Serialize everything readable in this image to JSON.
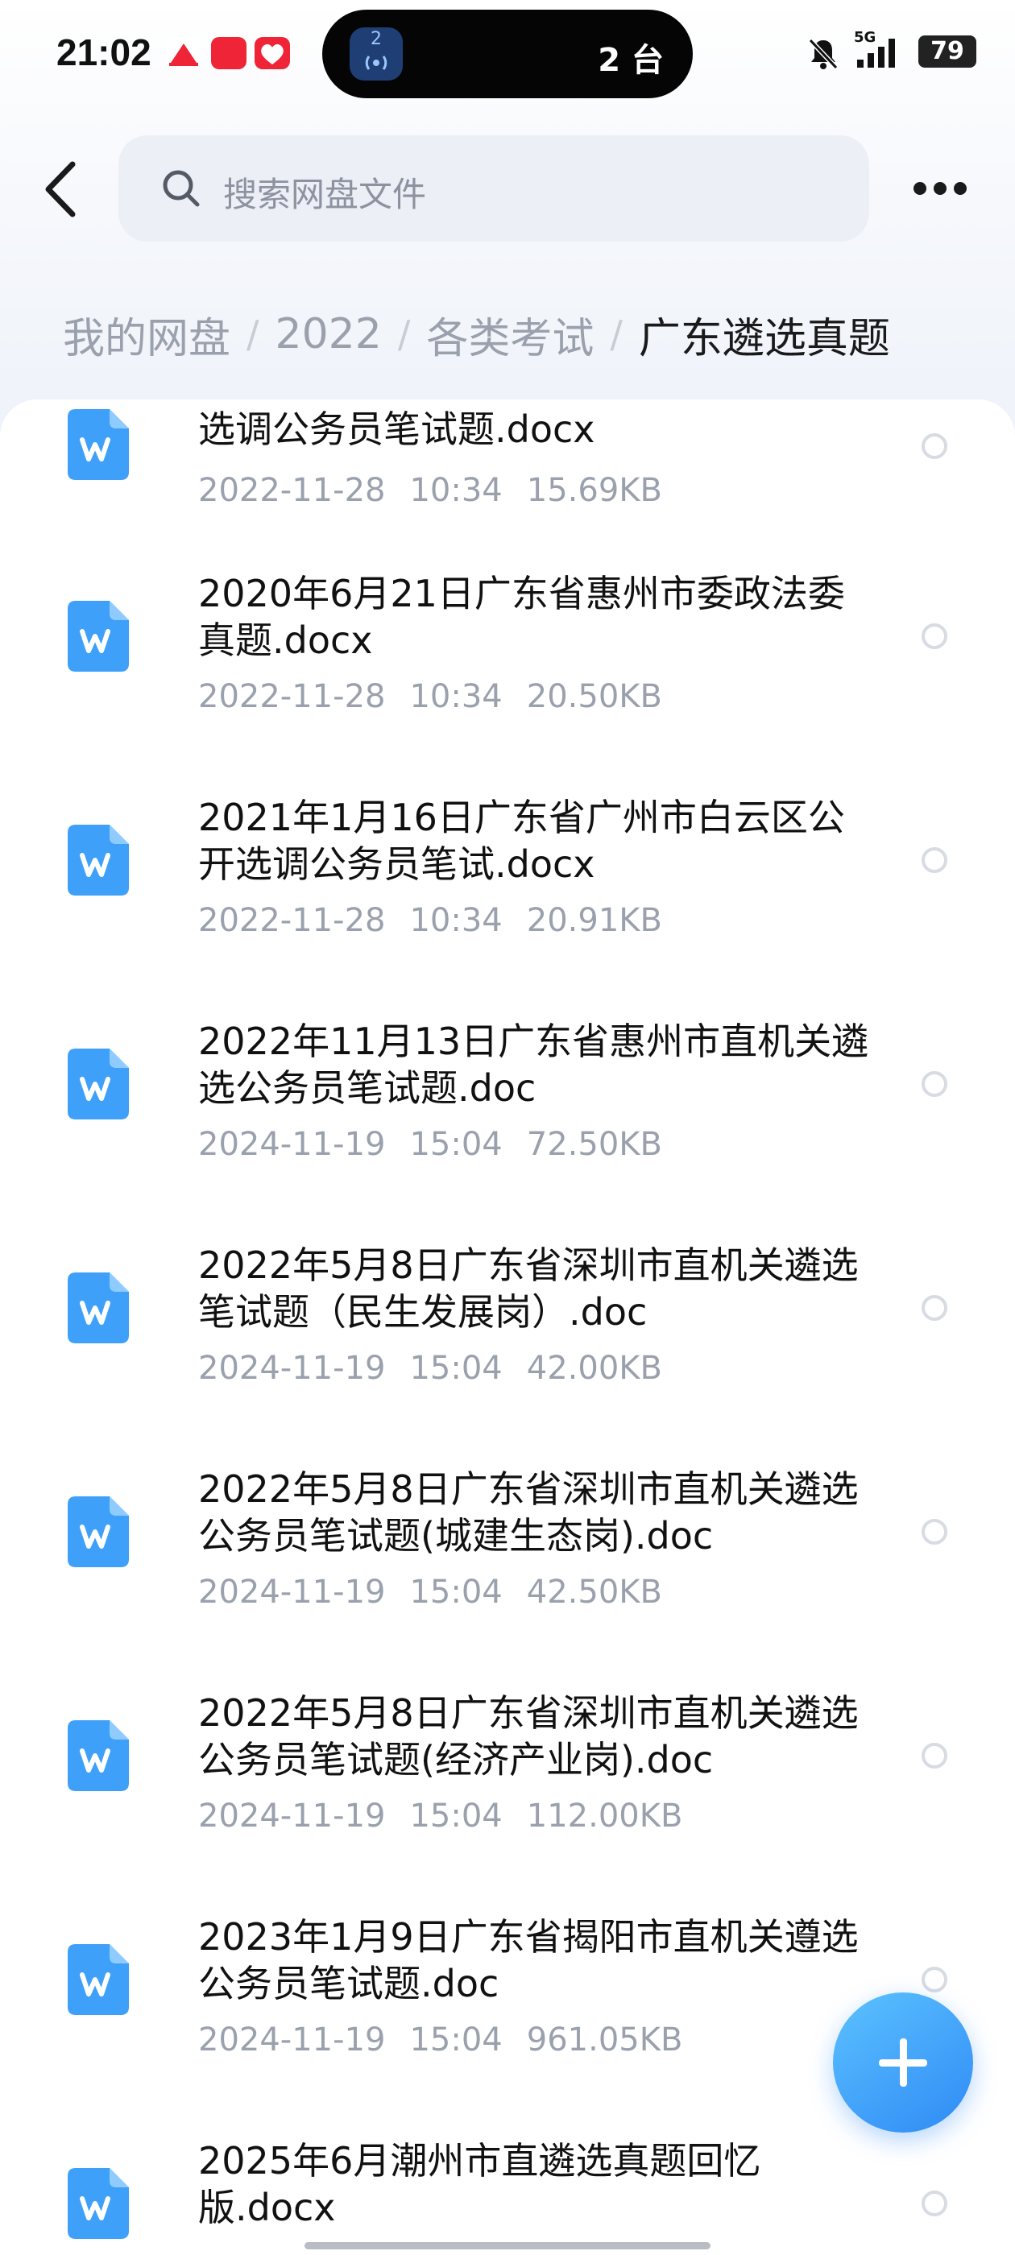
{
  "status_bar": {
    "time": "21:02",
    "island_badge": "2",
    "island_text": "2 台",
    "network": "5G",
    "battery": "79"
  },
  "search": {
    "placeholder": "搜索网盘文件"
  },
  "breadcrumb": {
    "items": [
      "我的网盘",
      "2022",
      "各类考试",
      "广东遴选真题"
    ],
    "separator": "/"
  },
  "files": [
    {
      "name": "选调公务员笔试题.docx",
      "date": "2022-11-28",
      "time": "10:34",
      "size": "15.69KB"
    },
    {
      "name": "2020年6月21日广东省惠州市委政法委真题.docx",
      "date": "2022-11-28",
      "time": "10:34",
      "size": "20.50KB"
    },
    {
      "name": "2021年1月16日广东省广州市白云区公开选调公务员笔试.docx",
      "date": "2022-11-28",
      "time": "10:34",
      "size": "20.91KB"
    },
    {
      "name": "2022年11月13日广东省惠州市直机关遴选公务员笔试题.doc",
      "date": "2024-11-19",
      "time": "15:04",
      "size": "72.50KB"
    },
    {
      "name": "2022年5月8日广东省深圳市直机关遴选笔试题（民生发展岗）.doc",
      "date": "2024-11-19",
      "time": "15:04",
      "size": "42.00KB"
    },
    {
      "name": "2022年5月8日广东省深圳市直机关遴选公务员笔试题(城建生态岗).doc",
      "date": "2024-11-19",
      "time": "15:04",
      "size": "42.50KB"
    },
    {
      "name": "2022年5月8日广东省深圳市直机关遴选公务员笔试题(经济产业岗).doc",
      "date": "2024-11-19",
      "time": "15:04",
      "size": "112.00KB"
    },
    {
      "name": "2023年1月9日广东省揭阳市直机关遵选公务员笔试题.doc",
      "date": "2024-11-19",
      "time": "15:04",
      "size": "961.05KB"
    },
    {
      "name": "2025年6月潮州市直遴选真题回忆版.docx",
      "date": "",
      "time": "",
      "size": ""
    }
  ],
  "icons": {
    "back": "chevron-left-icon",
    "search": "search-icon",
    "more": "more-horizontal-icon",
    "file": "word-doc-icon",
    "fab": "plus-icon"
  },
  "colors": {
    "accent": "#2f8af5",
    "doc_icon": "#3ea0f8",
    "muted_text": "#9aa1ad"
  }
}
